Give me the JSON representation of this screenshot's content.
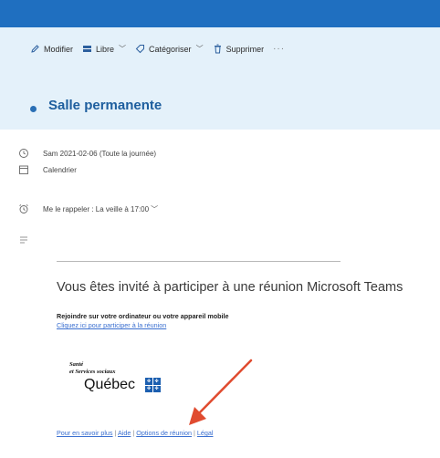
{
  "toolbar": {
    "edit_label": "Modifier",
    "free_label": "Libre",
    "categorize_label": "Catégoriser",
    "delete_label": "Supprimer",
    "more_label": "···"
  },
  "event": {
    "title": "Salle permanente",
    "date_text": "Sam 2021-02-06 (Toute la journée)",
    "calendar_label": "Calendrier",
    "reminder_text": "Me le rappeler : La veille à 17:00"
  },
  "body": {
    "invite_title": "Vous êtes invité à participer à une réunion Microsoft Teams",
    "join_heading": "Rejoindre sur votre ordinateur ou votre appareil mobile",
    "join_link": "Cliquez ici pour participer à la réunion",
    "logo": {
      "line1": "Santé",
      "line2": "et Services sociaux",
      "line3": "Québec"
    },
    "links": {
      "learn_more": "Pour en savoir plus",
      "help": "Aide",
      "meeting_options": "Options de réunion",
      "legal": "Légal",
      "separator": " | "
    }
  },
  "colors": {
    "topbar": "#1f6fc0",
    "toolbar_bg": "#e4f1fa",
    "title_color": "#1d5e9e",
    "link_color": "#3a6fd0",
    "arrow_color": "#e04b2f"
  },
  "icons": [
    "pencil-icon",
    "busy-status-icon",
    "tag-icon",
    "trash-icon",
    "clock-icon",
    "calendar-icon",
    "alarm-icon",
    "notes-icon",
    "annotation-arrow"
  ]
}
